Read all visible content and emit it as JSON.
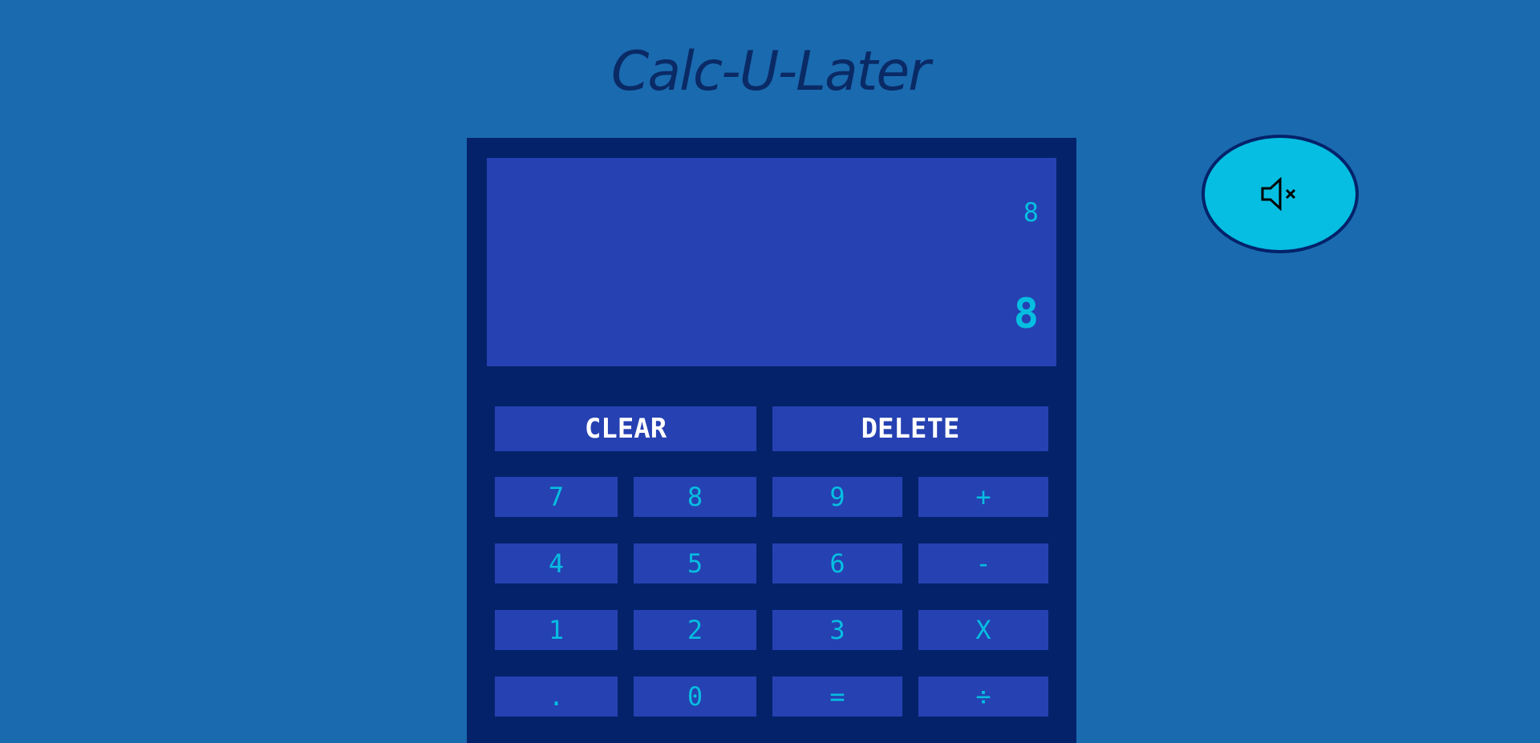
{
  "app": {
    "title": "Calc-U-Later"
  },
  "display": {
    "previous": "8",
    "current": "8"
  },
  "controls": {
    "clear_label": "CLEAR",
    "delete_label": "DELETE"
  },
  "keys": {
    "seven": "7",
    "eight": "8",
    "nine": "9",
    "add": "+",
    "four": "4",
    "five": "5",
    "six": "6",
    "subtract": "-",
    "one": "1",
    "two": "2",
    "three": "3",
    "multiply": "X",
    "decimal": ".",
    "zero": "0",
    "equals": "=",
    "divide": "÷"
  },
  "icons": {
    "mute": "speaker-muted-icon"
  },
  "colors": {
    "page_background": "#1a6aaf",
    "calculator_body": "#03226a",
    "display_and_keys": "#2541b2",
    "accent": "#06bee1",
    "title": "#0a2a66"
  }
}
